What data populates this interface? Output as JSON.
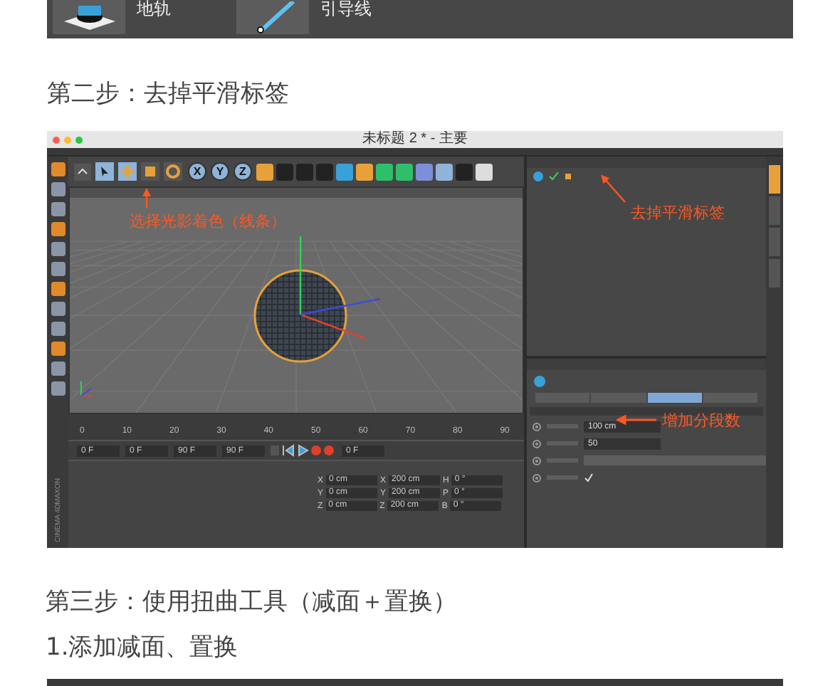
{
  "top_panel": {
    "tools": [
      {
        "label": "地轨"
      },
      {
        "label": "引导线"
      }
    ]
  },
  "step2_heading": "第二步：去掉平滑标签",
  "screenshot": {
    "title": "未标题 2 * - 主要",
    "axis_buttons": [
      "X",
      "Y",
      "Z"
    ],
    "annotations": [
      {
        "text": "选择光影着色（线条）"
      },
      {
        "text": "去掉平滑标签"
      },
      {
        "text": "增加分段数"
      }
    ],
    "timeline_ticks": [
      "0",
      "10",
      "20",
      "30",
      "40",
      "50",
      "60",
      "70",
      "80",
      "90"
    ],
    "transport_fields": [
      "0 F",
      "0 F",
      "90 F",
      "90 F",
      "0 F"
    ],
    "coordinates": [
      {
        "axis": "X",
        "position": "0 cm",
        "size_axis": "X",
        "size": "200 cm",
        "rot_axis": "H",
        "rotation": "0 °"
      },
      {
        "axis": "Y",
        "position": "0 cm",
        "size_axis": "Y",
        "size": "200 cm",
        "rot_axis": "P",
        "rotation": "0 °"
      },
      {
        "axis": "Z",
        "position": "0 cm",
        "size_axis": "Z",
        "size": "200 cm",
        "rot_axis": "B",
        "rotation": "0 °"
      }
    ],
    "attribute_tabs": [
      {
        "selected": false
      },
      {
        "selected": false
      },
      {
        "selected": true
      },
      {
        "selected": false
      }
    ],
    "attribute_fields": [
      {
        "kind": "input",
        "value": "100 cm"
      },
      {
        "kind": "input",
        "value": "50"
      },
      {
        "kind": "dropdown"
      },
      {
        "kind": "checkbox",
        "checked": true
      }
    ],
    "logo": [
      "MAXON",
      "CINEMA 4D"
    ]
  },
  "step3_heading": "第三步：使用扭曲工具（减面＋置换）",
  "step3_sub": "1.添加减面、置换"
}
